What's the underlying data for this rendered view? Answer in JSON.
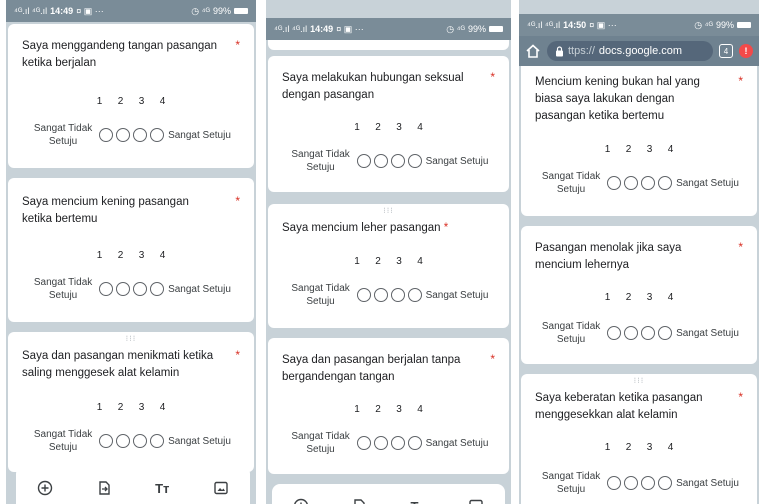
{
  "scale": {
    "numbers": [
      "1",
      "2",
      "3",
      "4"
    ],
    "low": "Sangat Tidak Setuju",
    "low_line1": "Sangat Tidak",
    "low_line2": "Setuju",
    "high": "Sangat Setuju"
  },
  "phones": [
    {
      "status": {
        "signal": "⁴ᴳ.ıl ⁴ᴳ.ıl",
        "time": "14:49",
        "notif": "¤ ▣ ···",
        "battery": "99%",
        "icons": "◷ ⁴ᴳ"
      },
      "questions": [
        {
          "text": "Saya menggandeng tangan pasangan ketika berjalan"
        },
        {
          "text": "Saya mencium kening pasangan ketika bertemu"
        },
        {
          "text": "Saya dan pasangan menikmati ketika saling menggesek alat kelamin"
        }
      ]
    },
    {
      "status": {
        "signal": "⁴ᴳ.ıl ⁴ᴳ.ıl",
        "time": "14:49",
        "notif": "¤ ▣ ···",
        "battery": "99%",
        "icons": "◷ ⁴ᴳ"
      },
      "questions": [
        {
          "text": "Saya melakukan hubungan seksual dengan pasangan"
        },
        {
          "text": "Saya mencium  leher pasangan"
        },
        {
          "text": "Saya dan pasangan berjalan tanpa bergandengan tangan"
        }
      ]
    },
    {
      "status": {
        "signal": "⁴ᴳ.ıl ⁴ᴳ.ıl",
        "time": "14:50",
        "notif": "¤ ▣ ···",
        "battery": "99%",
        "icons": "◷ ⁴ᴳ"
      },
      "url": {
        "prefix": "ttps://",
        "domain": "docs.google.com",
        "tabs": "4"
      },
      "questions": [
        {
          "text": "Mencium kening bukan hal yang biasa saya lakukan dengan pasangan ketika bertemu"
        },
        {
          "text": "Pasangan menolak jika saya mencium lehernya"
        },
        {
          "text": "Saya keberatan ketika pasangan menggesekkan alat kelamin"
        }
      ]
    }
  ],
  "required_mark": "*",
  "toolbar_icons": [
    "add-question-icon",
    "import-questions-icon",
    "add-title-icon",
    "add-image-icon"
  ],
  "toolbar_title_glyph": "Tт"
}
